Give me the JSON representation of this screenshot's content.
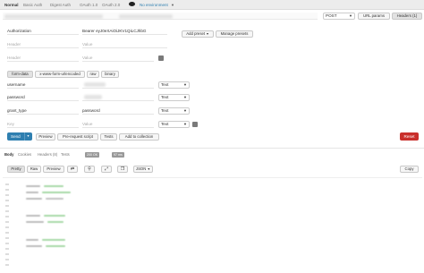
{
  "auth_tabs": [
    "Normal",
    "Basic Auth",
    "Digest Auth",
    "OAuth 1.0",
    "OAuth 2.0"
  ],
  "environment": {
    "label": "No environment",
    "icon": "eye-icon"
  },
  "url": {
    "value": ""
  },
  "method": "POST",
  "url_params_label": "URL params",
  "headers_label": "Headers (1)",
  "headers": [
    {
      "key": "Authorization",
      "value": "Bearer eyJ0eXAiOiJKV1QiLCJhbG"
    },
    {
      "key": "Header",
      "value": "Value"
    },
    {
      "key": "Header",
      "value": "Value"
    }
  ],
  "add_preset_label": "Add preset",
  "manage_presets_label": "Manage presets",
  "body_types": [
    "form-data",
    "x-www-form-urlencoded",
    "raw",
    "binary"
  ],
  "form_rows": [
    {
      "key": "username",
      "type": "Text"
    },
    {
      "key": "password",
      "type": "Text"
    },
    {
      "key": "grant_type",
      "value": "password",
      "type": "Text"
    },
    {
      "key": "Key",
      "value": "Value",
      "type": "Text"
    }
  ],
  "actions": {
    "send": "Send",
    "preview": "Preview",
    "prerequest": "Pre-request script",
    "tests": "Tests",
    "add_collection": "Add to collection",
    "reset": "Reset"
  },
  "response_tabs": [
    "Body",
    "Cookies",
    "Headers (8)",
    "Tests"
  ],
  "status": {
    "code": "200 OK",
    "time": "97 ms"
  },
  "view_modes": [
    "Pretty",
    "Raw",
    "Preview"
  ],
  "format": "JSON",
  "copy_label": "Copy",
  "colors": {
    "send": "#2f7fb0",
    "reset": "#c9302c",
    "header_bar": "#ececec"
  }
}
